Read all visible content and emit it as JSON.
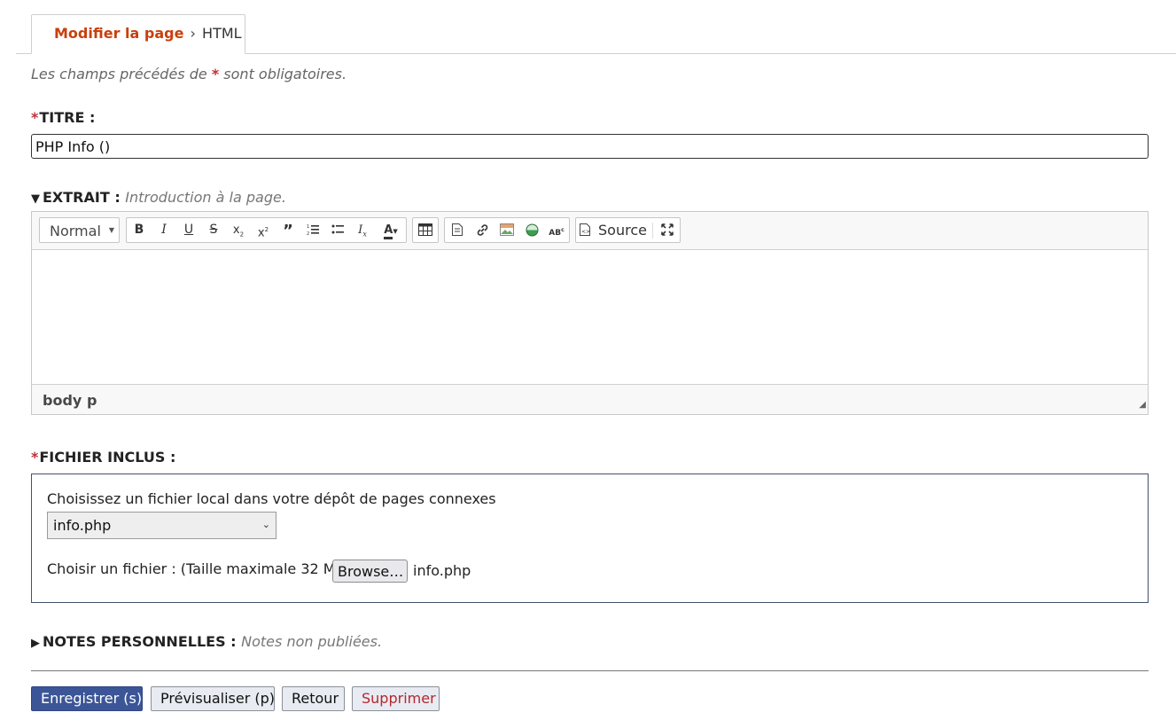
{
  "breadcrumb": {
    "link": "Modifier la page",
    "separator": "›",
    "current": "HTML"
  },
  "required_note": {
    "before": "Les champs précédés de",
    "star": "*",
    "after": "sont obligatoires."
  },
  "titre": {
    "star": "*",
    "label": "TITRE :",
    "value": "PHP Info ()"
  },
  "extrait": {
    "toggle": "▼",
    "label": "EXTRAIT :",
    "hint": "Introduction à la page.",
    "toolbar": {
      "format_combo": "Normal",
      "source_label": "Source",
      "icons": [
        "bold-icon",
        "italic-icon",
        "underline-icon",
        "strike-icon",
        "subscript-icon",
        "superscript-icon",
        "blockquote-icon",
        "numbered-list-icon",
        "bulleted-list-icon",
        "remove-format-icon",
        "text-color-icon",
        "table-icon",
        "template-icon",
        "link-icon",
        "image-icon",
        "media-icon",
        "abbr-icon",
        "source-icon",
        "maximize-icon"
      ]
    },
    "path": [
      "body",
      "p"
    ]
  },
  "fichier": {
    "star": "*",
    "label": "FICHIER INCLUS :",
    "choose_text": "Choisissez un fichier local dans votre dépôt de pages connexes",
    "selected": "info.php",
    "upload_text": "Choisir un fichier : (Taille maximale 32 MB)",
    "browse_label": "Browse…",
    "file_name": "info.php"
  },
  "notes": {
    "toggle": "▶",
    "label": "NOTES PERSONNELLES :",
    "hint": "Notes non publiées."
  },
  "buttons": {
    "save": "Enregistrer (s)",
    "preview": "Prévisualiser (p)",
    "back": "Retour",
    "delete": "Supprimer"
  },
  "colors": {
    "accent": "#c8400c",
    "required": "#c0303a",
    "primary_button": "#3b5597",
    "danger_text": "#b3282d"
  }
}
